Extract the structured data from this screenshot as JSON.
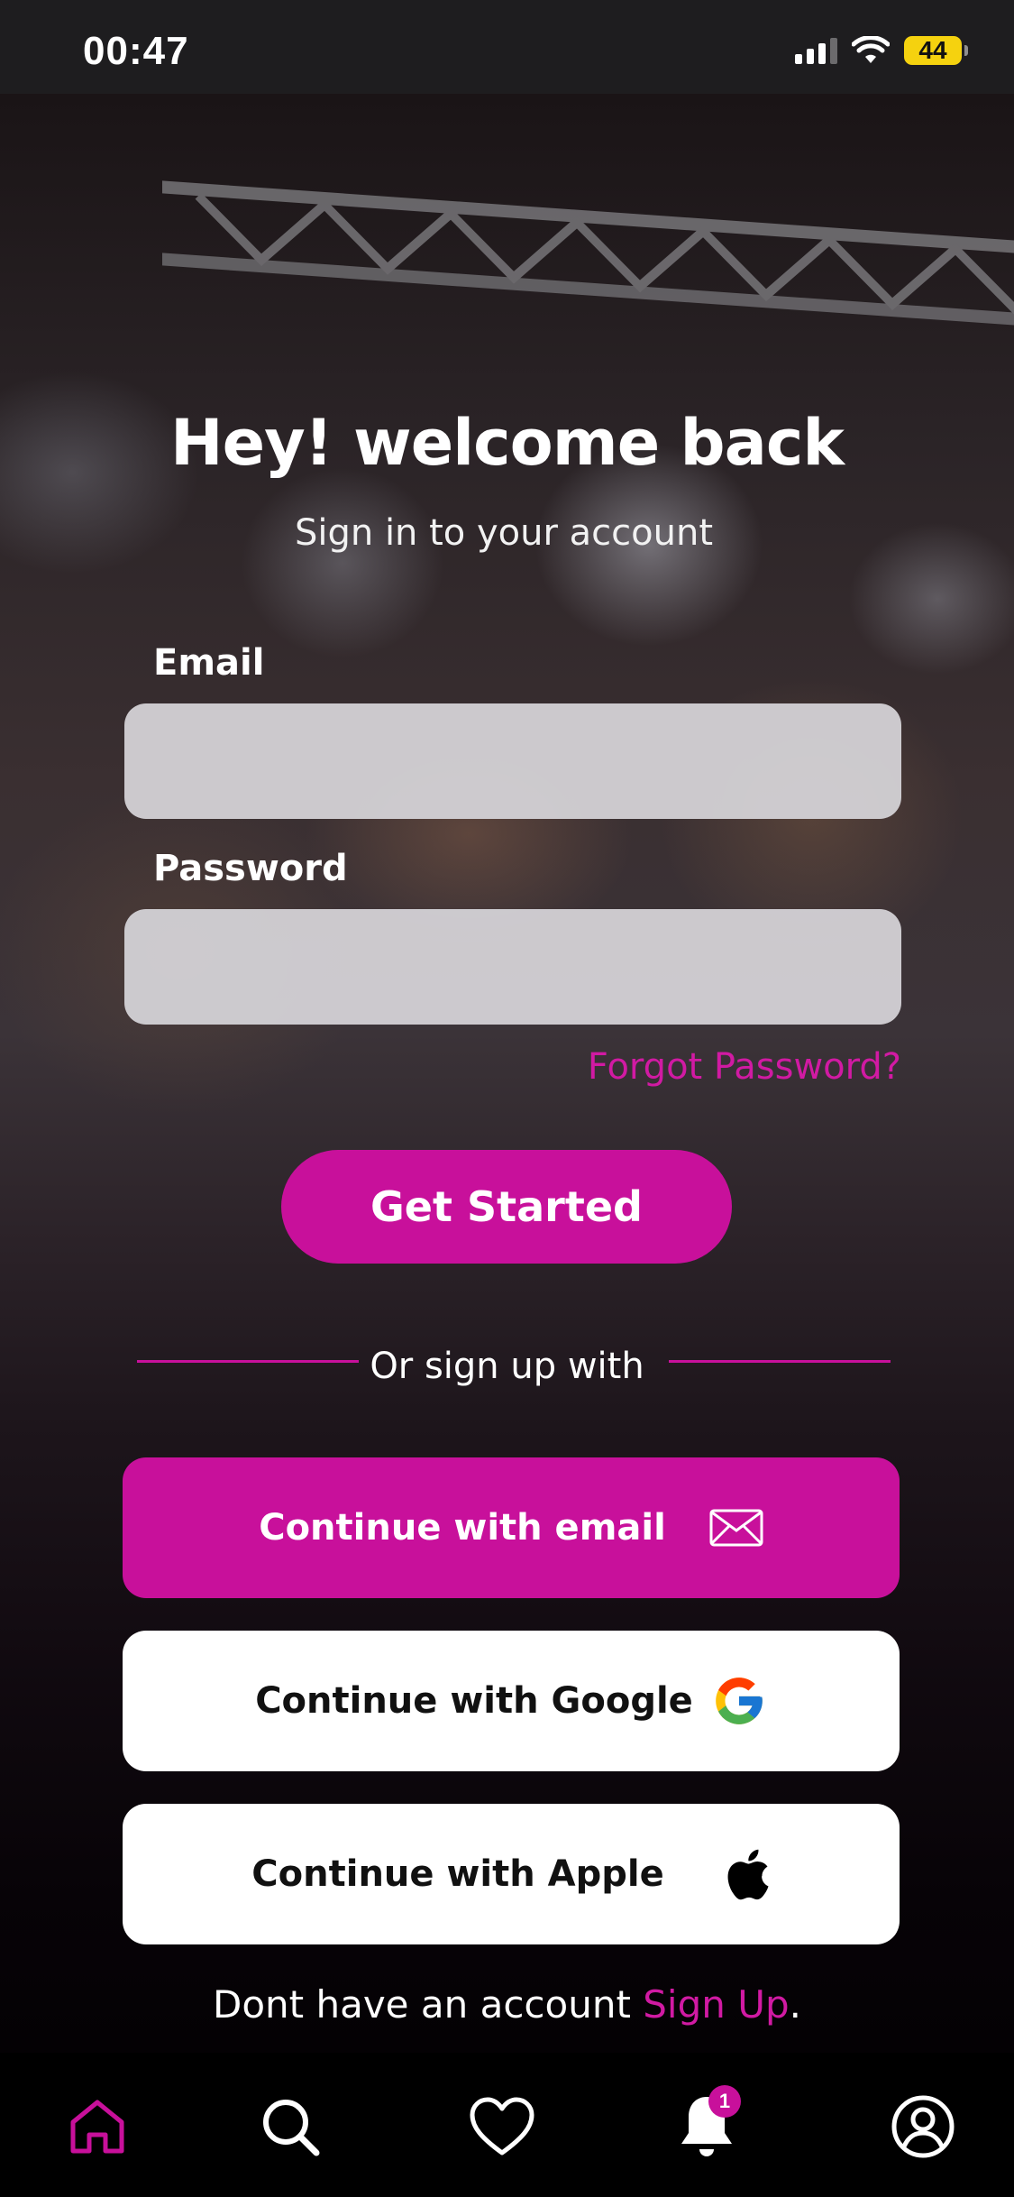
{
  "status_bar": {
    "time": "00:47",
    "battery_level": "44"
  },
  "header": {
    "title": "Hey! welcome back",
    "subtitle": "Sign in to your account"
  },
  "form": {
    "email_label": "Email",
    "email_value": "",
    "password_label": "Password",
    "password_value": "",
    "forgot_password": "Forgot Password?",
    "submit_label": "Get Started"
  },
  "divider": {
    "text": "Or sign up with"
  },
  "social": {
    "email_label": "Continue with email",
    "google_label": "Continue with Google",
    "apple_label": "Continue with Apple"
  },
  "footer": {
    "prompt": "Dont have an account ",
    "signup_link": "Sign Up",
    "period": "."
  },
  "tabbar": {
    "active_tab": "home",
    "notifications_count": "1",
    "items": [
      "home-icon",
      "search-icon",
      "heart-icon",
      "bell-icon",
      "profile-icon"
    ]
  },
  "colors": {
    "accent": "#c8109b",
    "link": "#d11aa3",
    "background_dark": "#050205",
    "field_bg": "#d4d2d6",
    "battery": "#f5d20f"
  }
}
